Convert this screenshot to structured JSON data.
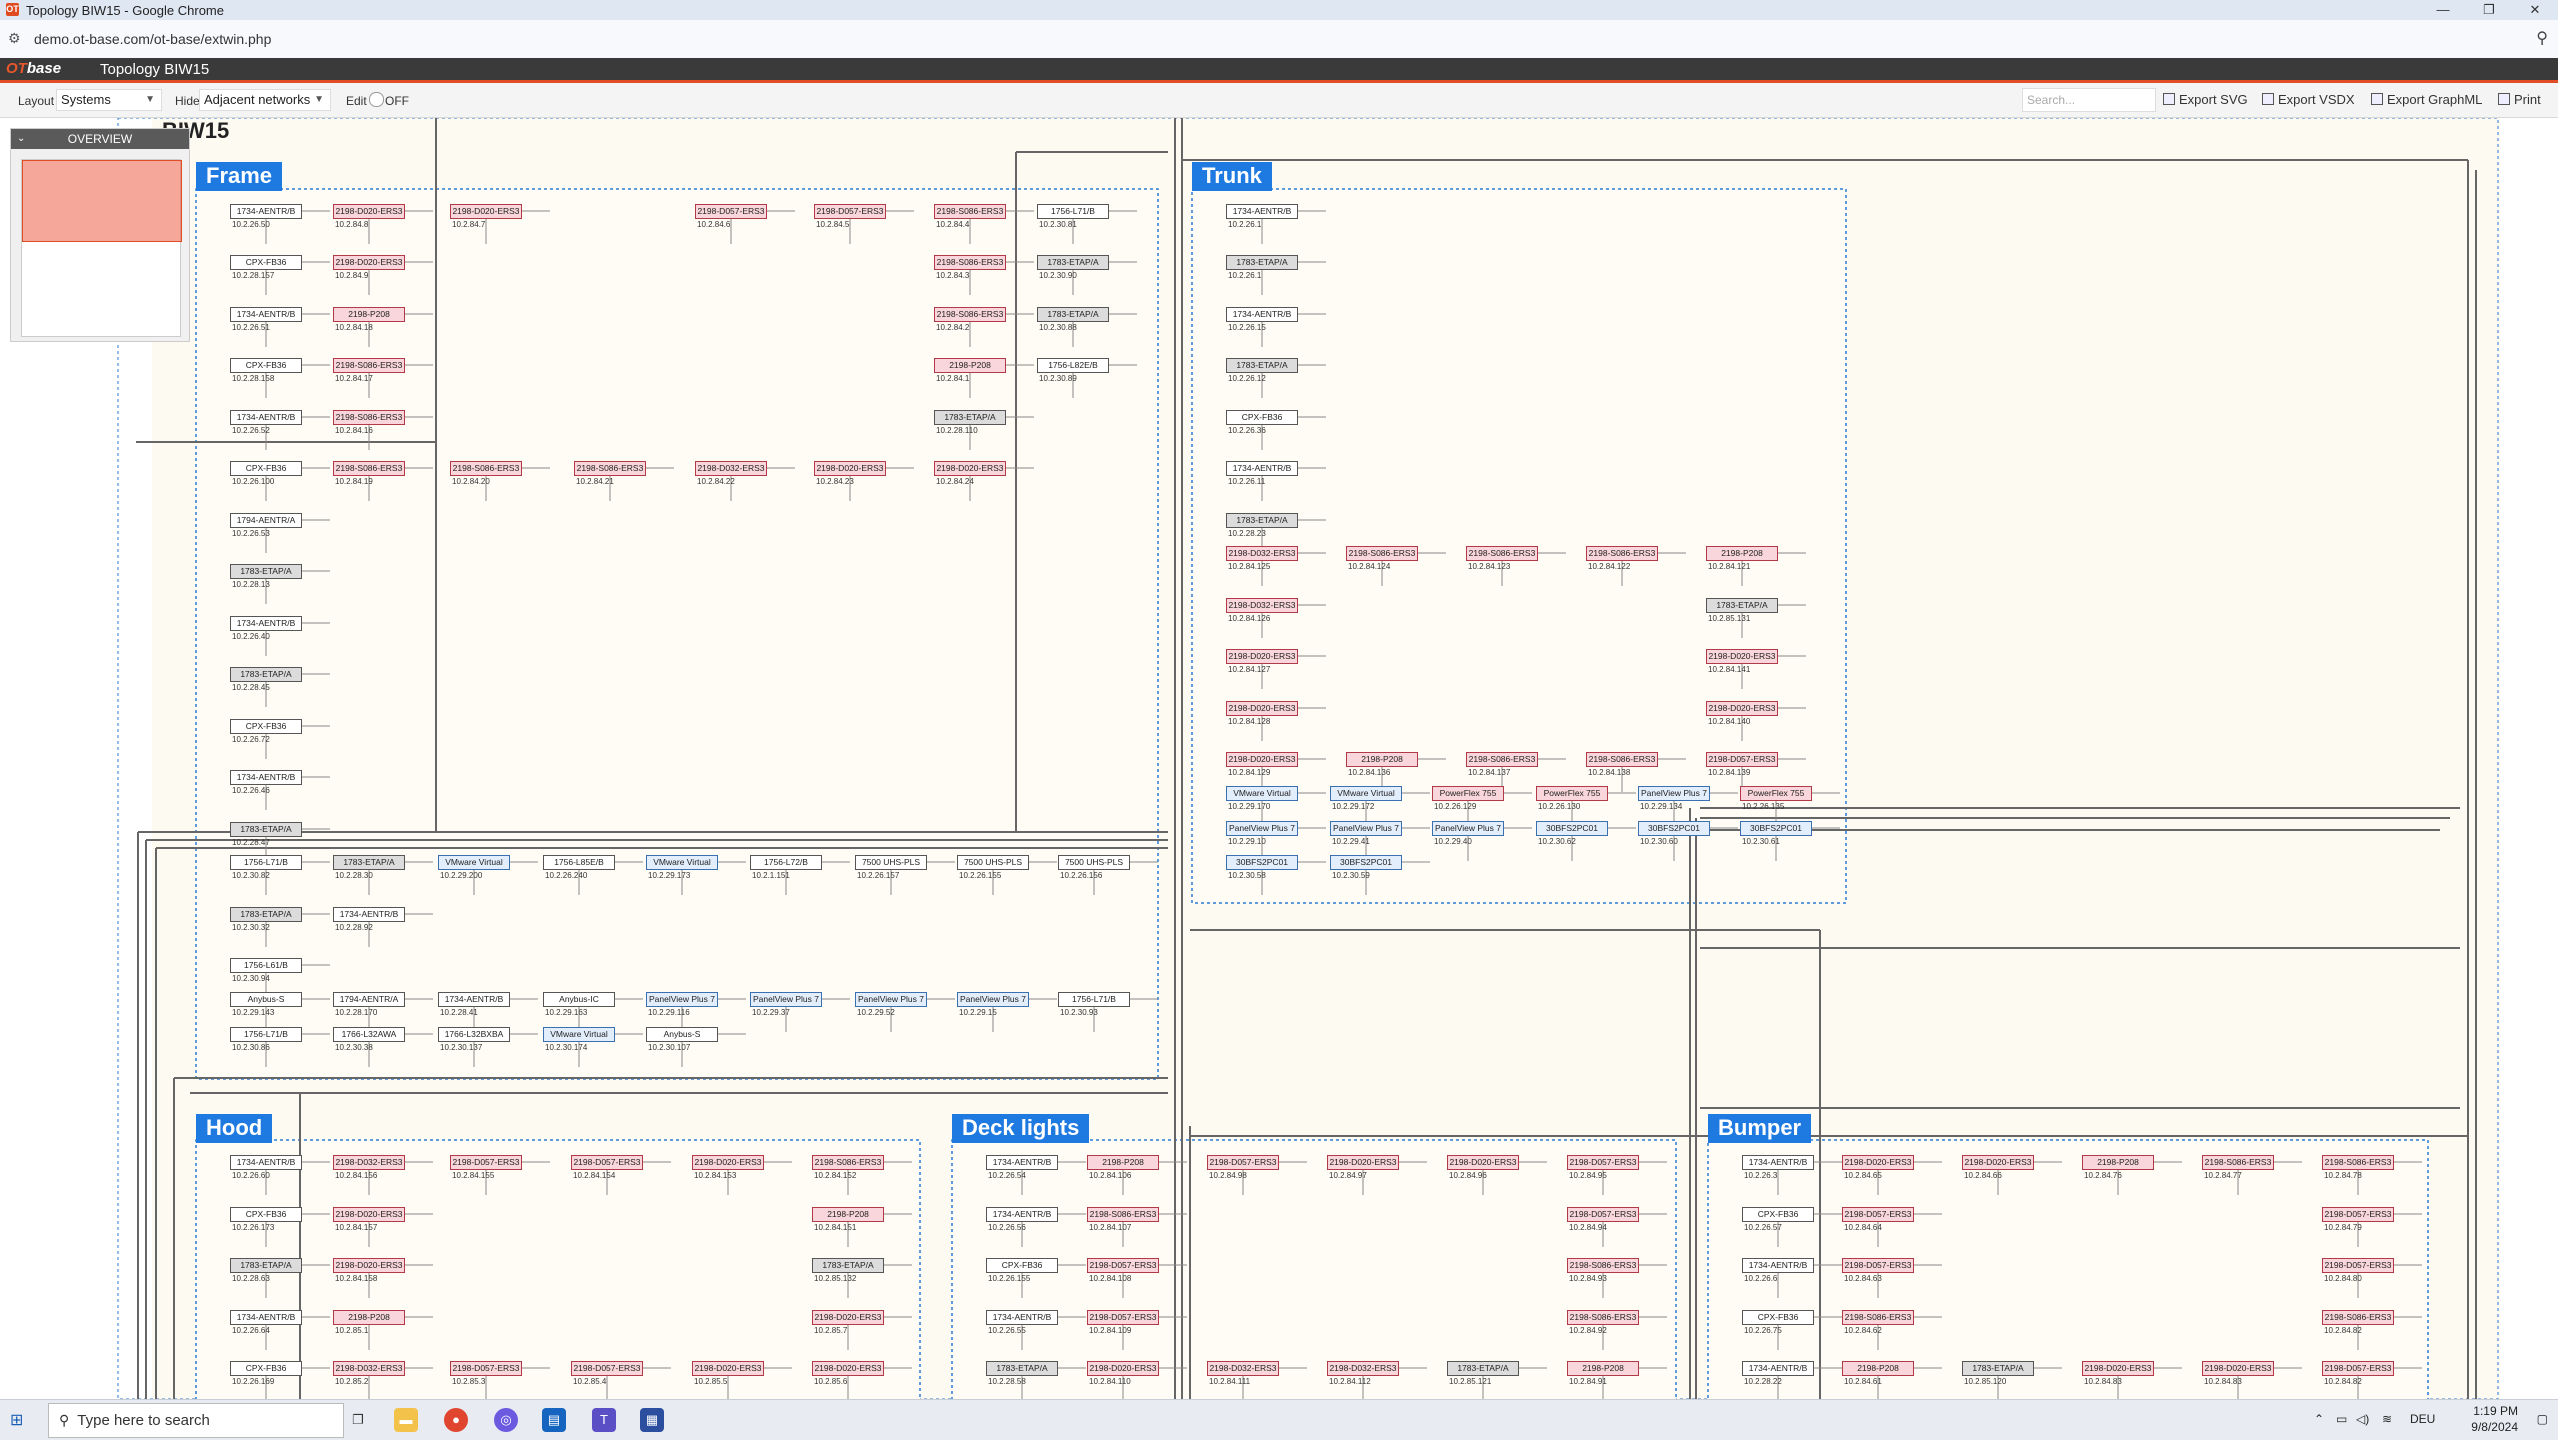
{
  "window": {
    "title": "Topology BIW15 - Google Chrome",
    "controls": [
      "—",
      "❐",
      "✕"
    ]
  },
  "browser": {
    "url": "demo.ot-base.com/ot-base/extwin.php"
  },
  "app": {
    "logo_a": "OT",
    "logo_b": "base",
    "title": "Topology BIW15"
  },
  "toolbar": {
    "layout_label": "Layout",
    "layout_value": "Systems",
    "hide_label": "Hide",
    "hide_value": "Adjacent networks",
    "edit_label": "Edit",
    "edit_value": "OFF",
    "search_placeholder": "Search...",
    "export_svg": "Export SVG",
    "export_vsdx": "Export VSDX",
    "export_graphml": "Export GraphML",
    "print": "Print"
  },
  "overview": {
    "title": "OVERVIEW"
  },
  "diagram": {
    "page_title": "BIW15",
    "groups": [
      {
        "name": "Frame"
      },
      {
        "name": "Trunk"
      },
      {
        "name": "Hood"
      },
      {
        "name": "Deck lights"
      },
      {
        "name": "Bumper"
      }
    ],
    "nodes": [
      {
        "label": "1734-AENTR/B",
        "ip": "10.2.26.50",
        "kind": "g"
      },
      {
        "label": "2198-D020-ERS3",
        "ip": "10.2.84.8",
        "kind": "d"
      },
      {
        "label": "2198-D020-ERS3",
        "ip": "10.2.84.7",
        "kind": "d"
      },
      {
        "label": "2198-D057-ERS3",
        "ip": "10.2.84.6",
        "kind": "d"
      },
      {
        "label": "2198-D057-ERS3",
        "ip": "10.2.84.5",
        "kind": "d"
      },
      {
        "label": "2198-S086-ERS3",
        "ip": "10.2.84.4",
        "kind": "d"
      },
      {
        "label": "1756-L71/B",
        "ip": "10.2.30.81",
        "kind": "g"
      },
      {
        "label": "CPX-FB36",
        "ip": "10.2.28.157",
        "kind": "g"
      },
      {
        "label": "2198-D020-ERS3",
        "ip": "10.2.84.9",
        "kind": "d"
      },
      {
        "label": "2198-S086-ERS3",
        "ip": "10.2.84.3",
        "kind": "d"
      },
      {
        "label": "1783-ETAP/A",
        "ip": "10.2.30.90",
        "kind": "e"
      },
      {
        "label": "1734-AENTR/B",
        "ip": "10.2.26.51",
        "kind": "g"
      },
      {
        "label": "2198-P208",
        "ip": "10.2.84.18",
        "kind": "d"
      },
      {
        "label": "2198-S086-ERS3",
        "ip": "10.2.84.2",
        "kind": "d"
      },
      {
        "label": "1783-ETAP/A",
        "ip": "10.2.30.88",
        "kind": "e"
      },
      {
        "label": "CPX-FB36",
        "ip": "10.2.28.158",
        "kind": "g"
      },
      {
        "label": "2198-S086-ERS3",
        "ip": "10.2.84.17",
        "kind": "d"
      },
      {
        "label": "2198-P208",
        "ip": "10.2.84.1",
        "kind": "d"
      },
      {
        "label": "1756-L82E/B",
        "ip": "10.2.30.89",
        "kind": "g"
      },
      {
        "label": "1734-AENTR/B",
        "ip": "10.2.26.52",
        "kind": "g"
      },
      {
        "label": "2198-S086-ERS3",
        "ip": "10.2.84.16",
        "kind": "d"
      },
      {
        "label": "1783-ETAP/A",
        "ip": "10.2.28.110",
        "kind": "e"
      },
      {
        "label": "CPX-FB36",
        "ip": "10.2.26.100",
        "kind": "g"
      },
      {
        "label": "2198-S086-ERS3",
        "ip": "10.2.84.19",
        "kind": "d"
      },
      {
        "label": "2198-S086-ERS3",
        "ip": "10.2.84.20",
        "kind": "d"
      },
      {
        "label": "2198-S086-ERS3",
        "ip": "10.2.84.21",
        "kind": "d"
      },
      {
        "label": "2198-D032-ERS3",
        "ip": "10.2.84.22",
        "kind": "d"
      },
      {
        "label": "2198-D020-ERS3",
        "ip": "10.2.84.23",
        "kind": "d"
      },
      {
        "label": "2198-D020-ERS3",
        "ip": "10.2.84.24",
        "kind": "d"
      },
      {
        "label": "1794-AENTR/A",
        "ip": "10.2.26.53",
        "kind": "g"
      },
      {
        "label": "1783-ETAP/A",
        "ip": "10.2.28.13",
        "kind": "e"
      },
      {
        "label": "1734-AENTR/B",
        "ip": "10.2.26.40",
        "kind": "g"
      },
      {
        "label": "1783-ETAP/A",
        "ip": "10.2.28.45",
        "kind": "e"
      },
      {
        "label": "CPX-FB36",
        "ip": "10.2.26.72",
        "kind": "g"
      },
      {
        "label": "1734-AENTR/B",
        "ip": "10.2.26.46",
        "kind": "g"
      },
      {
        "label": "1783-ETAP/A",
        "ip": "10.2.28.47",
        "kind": "e"
      },
      {
        "label": "1756-L71/B",
        "ip": "10.2.30.82",
        "kind": "g"
      },
      {
        "label": "1783-ETAP/A",
        "ip": "10.2.28.30",
        "kind": "e"
      },
      {
        "label": "VMware Virtual",
        "ip": "10.2.29.200",
        "kind": "b"
      },
      {
        "label": "1756-L85E/B",
        "ip": "10.2.26.240",
        "kind": "g"
      },
      {
        "label": "VMware Virtual",
        "ip": "10.2.29.173",
        "kind": "b"
      },
      {
        "label": "1756-L72/B",
        "ip": "10.2.1.151",
        "kind": "g"
      },
      {
        "label": "7500 UHS-PLS",
        "ip": "10.2.26.157",
        "kind": "g"
      },
      {
        "label": "7500 UHS-PLS",
        "ip": "10.2.26.155",
        "kind": "g"
      },
      {
        "label": "7500 UHS-PLS",
        "ip": "10.2.26.156",
        "kind": "g"
      },
      {
        "label": "1783-ETAP/A",
        "ip": "10.2.30.32",
        "kind": "e"
      },
      {
        "label": "1734-AENTR/B",
        "ip": "10.2.28.92",
        "kind": "g"
      },
      {
        "label": "1756-L61/B",
        "ip": "10.2.30.94",
        "kind": "g"
      },
      {
        "label": "Anybus-S",
        "ip": "10.2.29.143",
        "kind": "g"
      },
      {
        "label": "1794-AENTR/A",
        "ip": "10.2.28.170",
        "kind": "g"
      },
      {
        "label": "1734-AENTR/B",
        "ip": "10.2.28.41",
        "kind": "g"
      },
      {
        "label": "Anybus-IC",
        "ip": "10.2.29.163",
        "kind": "g"
      },
      {
        "label": "PanelView Plus 7",
        "ip": "10.2.29.116",
        "kind": "b"
      },
      {
        "label": "PanelView Plus 7",
        "ip": "10.2.29.37",
        "kind": "b"
      },
      {
        "label": "PanelView Plus 7",
        "ip": "10.2.29.52",
        "kind": "b"
      },
      {
        "label": "PanelView Plus 7",
        "ip": "10.2.29.15",
        "kind": "b"
      },
      {
        "label": "1756-L71/B",
        "ip": "10.2.30.93",
        "kind": "g"
      },
      {
        "label": "1756-L71/B",
        "ip": "10.2.30.86",
        "kind": "g"
      },
      {
        "label": "1766-L32AWA",
        "ip": "10.2.30.38",
        "kind": "g"
      },
      {
        "label": "1766-L32BXBA",
        "ip": "10.2.30.137",
        "kind": "g"
      },
      {
        "label": "VMware Virtual",
        "ip": "10.2.30.174",
        "kind": "b"
      },
      {
        "label": "Anybus-S",
        "ip": "10.2.30.107",
        "kind": "g"
      },
      {
        "label": "1734-AENTR/B",
        "ip": "10.2.26.1",
        "kind": "g"
      },
      {
        "label": "1783-ETAP/A",
        "ip": "10.2.26.1",
        "kind": "e"
      },
      {
        "label": "1734-AENTR/B",
        "ip": "10.2.26.15",
        "kind": "g"
      },
      {
        "label": "1783-ETAP/A",
        "ip": "10.2.26.12",
        "kind": "e"
      },
      {
        "label": "CPX-FB36",
        "ip": "10.2.26.36",
        "kind": "g"
      },
      {
        "label": "1734-AENTR/B",
        "ip": "10.2.26.11",
        "kind": "g"
      },
      {
        "label": "1783-ETAP/A",
        "ip": "10.2.28.23",
        "kind": "e"
      },
      {
        "label": "2198-D032-ERS3",
        "ip": "10.2.84.125",
        "kind": "d"
      },
      {
        "label": "2198-S086-ERS3",
        "ip": "10.2.84.124",
        "kind": "d"
      },
      {
        "label": "2198-S086-ERS3",
        "ip": "10.2.84.123",
        "kind": "d"
      },
      {
        "label": "2198-S086-ERS3",
        "ip": "10.2.84.122",
        "kind": "d"
      },
      {
        "label": "2198-P208",
        "ip": "10.2.84.121",
        "kind": "d"
      },
      {
        "label": "2198-D032-ERS3",
        "ip": "10.2.84.126",
        "kind": "d"
      },
      {
        "label": "1783-ETAP/A",
        "ip": "10.2.85.131",
        "kind": "e"
      },
      {
        "label": "2198-D020-ERS3",
        "ip": "10.2.84.127",
        "kind": "d"
      },
      {
        "label": "2198-D020-ERS3",
        "ip": "10.2.84.141",
        "kind": "d"
      },
      {
        "label": "2198-D020-ERS3",
        "ip": "10.2.84.128",
        "kind": "d"
      },
      {
        "label": "2198-D020-ERS3",
        "ip": "10.2.84.140",
        "kind": "d"
      },
      {
        "label": "2198-D020-ERS3",
        "ip": "10.2.84.129",
        "kind": "d"
      },
      {
        "label": "2198-P208",
        "ip": "10.2.84.136",
        "kind": "d"
      },
      {
        "label": "2198-S086-ERS3",
        "ip": "10.2.84.137",
        "kind": "d"
      },
      {
        "label": "2198-S086-ERS3",
        "ip": "10.2.84.138",
        "kind": "d"
      },
      {
        "label": "2198-D057-ERS3",
        "ip": "10.2.84.139",
        "kind": "d"
      },
      {
        "label": "VMware Virtual",
        "ip": "10.2.29.170",
        "kind": "b"
      },
      {
        "label": "VMware Virtual",
        "ip": "10.2.29.172",
        "kind": "b"
      },
      {
        "label": "PowerFlex 755",
        "ip": "10.2.26.129",
        "kind": "d"
      },
      {
        "label": "PowerFlex 755",
        "ip": "10.2.26.130",
        "kind": "d"
      },
      {
        "label": "PanelView Plus 7",
        "ip": "10.2.29.134",
        "kind": "b"
      },
      {
        "label": "PowerFlex 755",
        "ip": "10.2.26.135",
        "kind": "d"
      },
      {
        "label": "PanelView Plus 7",
        "ip": "10.2.29.10",
        "kind": "b"
      },
      {
        "label": "PanelView Plus 7",
        "ip": "10.2.29.41",
        "kind": "b"
      },
      {
        "label": "PanelView Plus 7",
        "ip": "10.2.29.40",
        "kind": "b"
      },
      {
        "label": "30BFS2PC01",
        "ip": "10.2.30.62",
        "kind": "b"
      },
      {
        "label": "30BFS2PC01",
        "ip": "10.2.30.60",
        "kind": "b"
      },
      {
        "label": "30BFS2PC01",
        "ip": "10.2.30.61",
        "kind": "b"
      },
      {
        "label": "30BFS2PC01",
        "ip": "10.2.30.58",
        "kind": "b"
      },
      {
        "label": "30BFS2PC01",
        "ip": "10.2.30.59",
        "kind": "b"
      },
      {
        "label": "1734-AENTR/B",
        "ip": "10.2.26.60",
        "kind": "g"
      },
      {
        "label": "2198-D032-ERS3",
        "ip": "10.2.84.156",
        "kind": "d"
      },
      {
        "label": "2198-D057-ERS3",
        "ip": "10.2.84.155",
        "kind": "d"
      },
      {
        "label": "2198-D057-ERS3",
        "ip": "10.2.84.154",
        "kind": "d"
      },
      {
        "label": "2198-D020-ERS3",
        "ip": "10.2.84.153",
        "kind": "d"
      },
      {
        "label": "2198-S086-ERS3",
        "ip": "10.2.84.152",
        "kind": "d"
      },
      {
        "label": "CPX-FB36",
        "ip": "10.2.26.173",
        "kind": "g"
      },
      {
        "label": "2198-D020-ERS3",
        "ip": "10.2.84.157",
        "kind": "d"
      },
      {
        "label": "2198-P208",
        "ip": "10.2.84.151",
        "kind": "d"
      },
      {
        "label": "1783-ETAP/A",
        "ip": "10.2.28.63",
        "kind": "e"
      },
      {
        "label": "2198-D020-ERS3",
        "ip": "10.2.84.158",
        "kind": "d"
      },
      {
        "label": "1783-ETAP/A",
        "ip": "10.2.85.132",
        "kind": "e"
      },
      {
        "label": "1734-AENTR/B",
        "ip": "10.2.26.64",
        "kind": "g"
      },
      {
        "label": "2198-P208",
        "ip": "10.2.85.1",
        "kind": "d"
      },
      {
        "label": "2198-D020-ERS3",
        "ip": "10.2.85.7",
        "kind": "d"
      },
      {
        "label": "CPX-FB36",
        "ip": "10.2.26.169",
        "kind": "g"
      },
      {
        "label": "2198-D032-ERS3",
        "ip": "10.2.85.2",
        "kind": "d"
      },
      {
        "label": "2198-D057-ERS3",
        "ip": "10.2.85.3",
        "kind": "d"
      },
      {
        "label": "2198-D057-ERS3",
        "ip": "10.2.85.4",
        "kind": "d"
      },
      {
        "label": "2198-D020-ERS3",
        "ip": "10.2.85.5",
        "kind": "d"
      },
      {
        "label": "2198-D020-ERS3",
        "ip": "10.2.85.6",
        "kind": "d"
      },
      {
        "label": "1734-AENTR/B",
        "ip": "10.2.26.54",
        "kind": "g"
      },
      {
        "label": "2198-P208",
        "ip": "10.2.84.106",
        "kind": "d"
      },
      {
        "label": "2198-D057-ERS3",
        "ip": "10.2.84.98",
        "kind": "d"
      },
      {
        "label": "2198-D020-ERS3",
        "ip": "10.2.84.97",
        "kind": "d"
      },
      {
        "label": "2198-D020-ERS3",
        "ip": "10.2.84.96",
        "kind": "d"
      },
      {
        "label": "2198-D057-ERS3",
        "ip": "10.2.84.95",
        "kind": "d"
      },
      {
        "label": "1734-AENTR/B",
        "ip": "10.2.26.56",
        "kind": "g"
      },
      {
        "label": "2198-S086-ERS3",
        "ip": "10.2.84.107",
        "kind": "d"
      },
      {
        "label": "2198-D057-ERS3",
        "ip": "10.2.84.94",
        "kind": "d"
      },
      {
        "label": "CPX-FB36",
        "ip": "10.2.26.155",
        "kind": "g"
      },
      {
        "label": "2198-D057-ERS3",
        "ip": "10.2.84.108",
        "kind": "d"
      },
      {
        "label": "2198-S086-ERS3",
        "ip": "10.2.84.93",
        "kind": "d"
      },
      {
        "label": "1734-AENTR/B",
        "ip": "10.2.26.55",
        "kind": "g"
      },
      {
        "label": "2198-D057-ERS3",
        "ip": "10.2.84.109",
        "kind": "d"
      },
      {
        "label": "2198-S086-ERS3",
        "ip": "10.2.84.92",
        "kind": "d"
      },
      {
        "label": "1783-ETAP/A",
        "ip": "10.2.28.58",
        "kind": "e"
      },
      {
        "label": "2198-D020-ERS3",
        "ip": "10.2.84.110",
        "kind": "d"
      },
      {
        "label": "2198-D032-ERS3",
        "ip": "10.2.84.111",
        "kind": "d"
      },
      {
        "label": "2198-D032-ERS3",
        "ip": "10.2.84.112",
        "kind": "d"
      },
      {
        "label": "1783-ETAP/A",
        "ip": "10.2.85.121",
        "kind": "e"
      },
      {
        "label": "2198-P208",
        "ip": "10.2.84.91",
        "kind": "d"
      },
      {
        "label": "1734-AENTR/B",
        "ip": "10.2.26.3",
        "kind": "g"
      },
      {
        "label": "2198-D020-ERS3",
        "ip": "10.2.84.65",
        "kind": "d"
      },
      {
        "label": "2198-D020-ERS3",
        "ip": "10.2.84.66",
        "kind": "d"
      },
      {
        "label": "2198-P208",
        "ip": "10.2.84.76",
        "kind": "d"
      },
      {
        "label": "2198-S086-ERS3",
        "ip": "10.2.84.77",
        "kind": "d"
      },
      {
        "label": "2198-S086-ERS3",
        "ip": "10.2.84.78",
        "kind": "d"
      },
      {
        "label": "CPX-FB36",
        "ip": "10.2.26.57",
        "kind": "g"
      },
      {
        "label": "2198-D057-ERS3",
        "ip": "10.2.84.64",
        "kind": "d"
      },
      {
        "label": "2198-D057-ERS3",
        "ip": "10.2.84.79",
        "kind": "d"
      },
      {
        "label": "1734-AENTR/B",
        "ip": "10.2.26.6",
        "kind": "g"
      },
      {
        "label": "2198-D057-ERS3",
        "ip": "10.2.84.63",
        "kind": "d"
      },
      {
        "label": "2198-D057-ERS3",
        "ip": "10.2.84.80",
        "kind": "d"
      },
      {
        "label": "CPX-FB36",
        "ip": "10.2.26.75",
        "kind": "g"
      },
      {
        "label": "2198-S086-ERS3",
        "ip": "10.2.84.62",
        "kind": "d"
      },
      {
        "label": "2198-S086-ERS3",
        "ip": "10.2.84.82",
        "kind": "d"
      },
      {
        "label": "1734-AENTR/B",
        "ip": "10.2.28.22",
        "kind": "g"
      },
      {
        "label": "2198-P208",
        "ip": "10.2.84.61",
        "kind": "d"
      },
      {
        "label": "1783-ETAP/A",
        "ip": "10.2.85.120",
        "kind": "e"
      },
      {
        "label": "2198-D020-ERS3",
        "ip": "10.2.84.83",
        "kind": "d"
      },
      {
        "label": "2198-D020-ERS3",
        "ip": "10.2.84.83",
        "kind": "d"
      },
      {
        "label": "2198-D057-ERS3",
        "ip": "10.2.84.82",
        "kind": "d"
      }
    ]
  },
  "taskbar": {
    "search_placeholder": "Type here to search",
    "lang": "DEU",
    "time": "1:19 PM",
    "date": "9/8/2024"
  },
  "colors": {
    "accent": "#1e7ae0",
    "brand": "#e14d24",
    "drive_fill": "#f9d6db",
    "group_border": "#2a7bd6"
  }
}
